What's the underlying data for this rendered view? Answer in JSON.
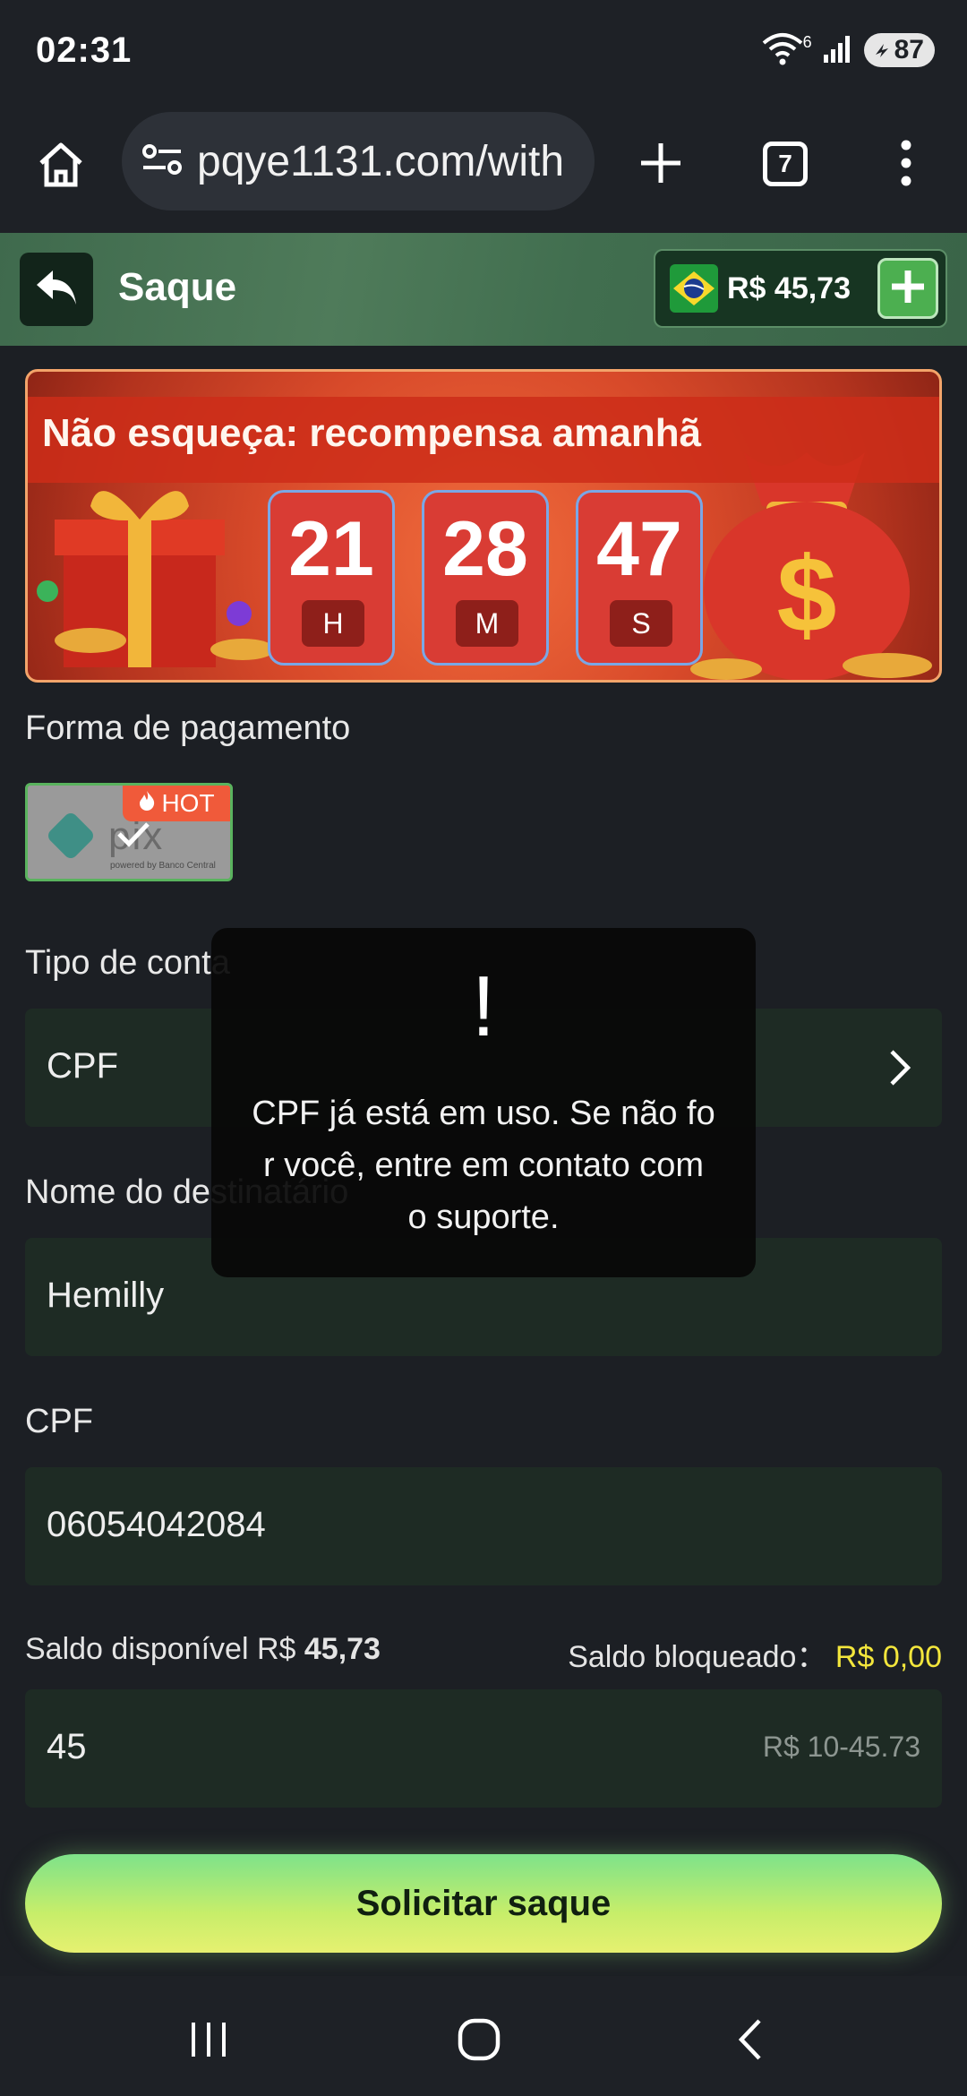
{
  "status_bar": {
    "time": "02:31",
    "wifi_badge": "6",
    "battery": "87",
    "icons": [
      "wifi-icon",
      "signal-icon",
      "battery-icon"
    ]
  },
  "browser": {
    "url": "pqye1131.com/with",
    "tab_count": "7",
    "icons": [
      "home-icon",
      "site-settings-icon",
      "new-tab-icon",
      "tabs-icon",
      "more-icon"
    ]
  },
  "header": {
    "title": "Saque",
    "balance": "R$ 45,73"
  },
  "banner": {
    "title": "Não esqueça: recompensa amanhã",
    "countdown": [
      {
        "value": "21",
        "unit": "H"
      },
      {
        "value": "28",
        "unit": "M"
      },
      {
        "value": "47",
        "unit": "S"
      }
    ]
  },
  "form": {
    "payment_label": "Forma de pagamento",
    "payment_method": "pix",
    "payment_subtext": "powered by Banco Central",
    "hot_badge": "HOT",
    "account_type_label": "Tipo de conta",
    "account_type_value": "CPF",
    "recipient_label": "Nome do destinatário",
    "recipient_value": "Hemilly",
    "cpf_label": "CPF",
    "cpf_value": "06054042084",
    "available_label": "Saldo disponível R$",
    "available_value": "45,73",
    "blocked_label": "Saldo bloqueado：",
    "blocked_value": "R$ 0,00",
    "amount_value": "45",
    "amount_range": "R$ 10-45.73",
    "submit_label": "Solicitar saque"
  },
  "toast": {
    "icon": "!",
    "message": "CPF já está em uso. Se não for você, entre em contato com o suporte."
  },
  "colors": {
    "background": "#1c1f24",
    "field": "#1e2b24",
    "accent_green": "#4caf50",
    "highlight_yellow": "#f3e63c"
  }
}
